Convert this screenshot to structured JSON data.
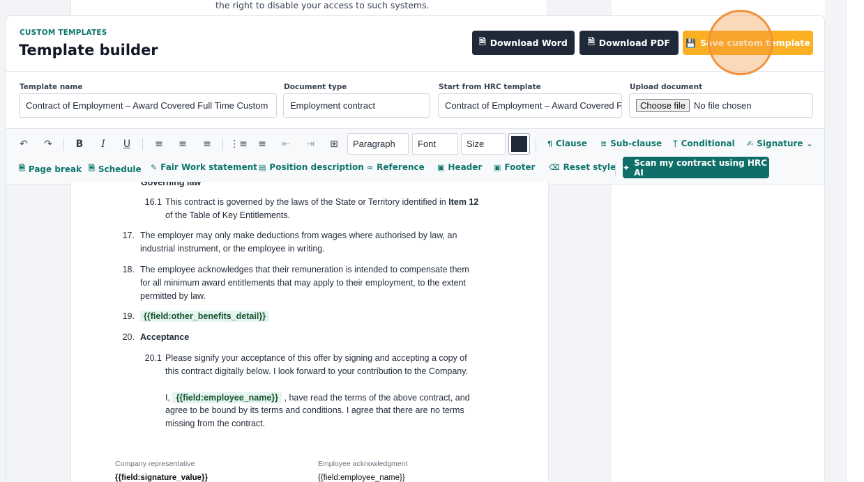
{
  "background": {
    "prev_text": "the right to disable your access to such systems."
  },
  "header": {
    "eyebrow": "CUSTOM TEMPLATES",
    "title": "Template builder",
    "download_word": "Download Word",
    "download_pdf": "Download PDF",
    "save_template": "Save custom template"
  },
  "fields": {
    "template_name_label": "Template name",
    "template_name_value": "Contract of Employment – Award Covered Full Time  Custom",
    "document_type_label": "Document type",
    "document_type_value": "Employment contract",
    "start_from_label": "Start from HRC template",
    "start_from_value": "Contract of Employment – Award Covered Full Time",
    "upload_label": "Upload document",
    "upload_button": "Choose file",
    "upload_status": "No file chosen"
  },
  "toolbar": {
    "paragraph": "Paragraph",
    "font": "Font",
    "size": "Size",
    "text_color": "#1f2937",
    "clause": "Clause",
    "sub_clause": "Sub-clause",
    "conditional": "Conditional",
    "signature": "Signature",
    "page_break": "Page break",
    "schedule": "Schedule",
    "fair_work": "Fair Work statement",
    "position_description": "Position description",
    "reference": "Reference",
    "header": "Header",
    "footer": "Footer",
    "reset_style": "Reset style",
    "scan": "Scan my contract using HRC AI"
  },
  "document": {
    "partial_heading": "Governing law",
    "c16_1_num": "16.1",
    "c16_1_a": "This contract is governed by the laws of the State or Territory identified in",
    "c16_1_bold": "Item 12",
    "c16_1_b": "of the Table of Key Entitlements.",
    "c17_num": "17.",
    "c17_a": "The employer may only make deductions from wages where authorised by law, an",
    "c17_b": "industrial instrument, or the employee in writing.",
    "c18_num": "18.",
    "c18_a": "The employee acknowledges that their remuneration is intended to compensate them",
    "c18_b": "for all minimum award entitlements that may apply to their employment, to the extent",
    "c18_c": "permitted by law.",
    "c19_num": "19.",
    "c19_field": "{{field:other_benefits_detail}}",
    "c20_num": "20.",
    "c20_title": "Acceptance",
    "c20_1_num": "20.1",
    "c20_1_a": "Please signify your acceptance of this offer by signing and accepting a copy of",
    "c20_1_b": "this contract digitally below.  I look forward to your contribution to the Company.",
    "c20_1_i": "I,",
    "c20_1_field": "{{field:employee_name}}",
    "c20_1_c": ", have read the terms of the above contract, and",
    "c20_1_d": "agree to be bound by its terms and conditions. I agree that there are no terms",
    "c20_1_e": "missing from the contract.",
    "sig_company_label": "Company representative",
    "sig_company_value": "{{field:signature_value}}",
    "sig_employee_label": "Employee acknowledgment",
    "sig_employee_value": "{{field:employee_name}}"
  }
}
